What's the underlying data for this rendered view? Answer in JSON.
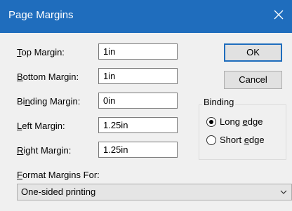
{
  "window": {
    "title": "Page Margins",
    "close_icon": "close-icon",
    "accent": "#1f6dbd"
  },
  "margins": [
    {
      "key": "T",
      "rest": "op Margin:",
      "value": "1in"
    },
    {
      "key": "B",
      "rest": "ottom Margin:",
      "value": "1in"
    },
    {
      "pre": "Bi",
      "key": "n",
      "rest": "ding Margin:",
      "value": "0in"
    },
    {
      "key": "L",
      "rest": "eft Margin:",
      "value": "1.25in"
    },
    {
      "key": "R",
      "rest": "ight Margin:",
      "value": "1.25in"
    }
  ],
  "buttons": {
    "ok": "OK",
    "cancel": "Cancel"
  },
  "binding": {
    "legend": "Binding",
    "options": [
      {
        "pre": "Long ",
        "key": "e",
        "rest": "dge",
        "selected": true
      },
      {
        "pre": "Short ",
        "key": "e",
        "rest": "dge",
        "selected": false
      }
    ]
  },
  "format": {
    "key": "F",
    "rest": "ormat Margins For:",
    "selected": "One-sided printing",
    "chevron_icon": "chevron-down-icon"
  }
}
